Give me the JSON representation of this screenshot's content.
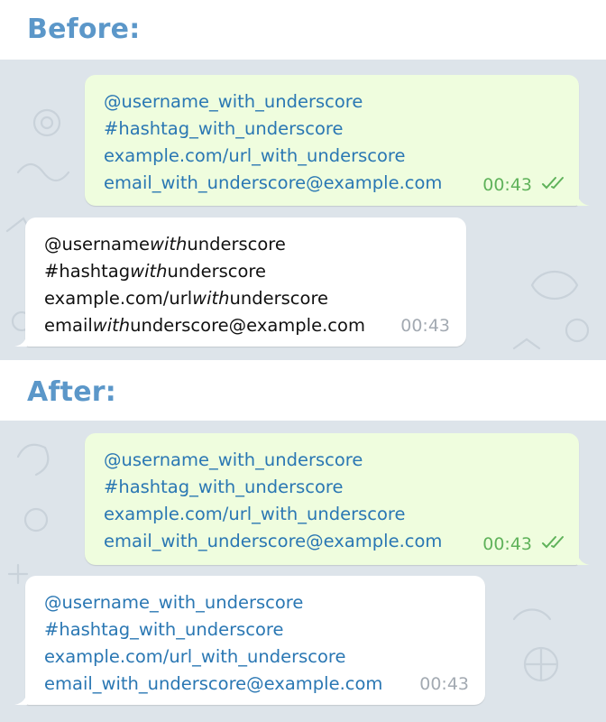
{
  "before": {
    "heading": "Before:",
    "sent_message": {
      "lines": [
        "@username_with_underscore",
        "#hashtag_with_underscore",
        "example.com/url_with_underscore",
        "email_with_underscore@example.com"
      ],
      "time": "00:43",
      "status_icon": "double-check-icon"
    },
    "received_message": {
      "lines": [
        {
          "pre": "@username",
          "ital": "with",
          "post": "underscore"
        },
        {
          "pre": "#hashtag",
          "ital": "with",
          "post": "underscore"
        },
        {
          "pre": "example.com/url",
          "ital": "with",
          "post": "underscore"
        },
        {
          "pre": "email",
          "ital": "with",
          "post": "underscore@example.com"
        }
      ],
      "time": "00:43"
    }
  },
  "after": {
    "heading": "After:",
    "sent_message": {
      "lines": [
        "@username_with_underscore",
        "#hashtag_with_underscore",
        "example.com/url_with_underscore",
        "email_with_underscore@example.com"
      ],
      "time": "00:43",
      "status_icon": "double-check-icon"
    },
    "received_message": {
      "lines": [
        "@username_with_underscore",
        "#hashtag_with_underscore",
        "example.com/url_with_underscore",
        "email_with_underscore@example.com"
      ],
      "time": "00:43"
    }
  },
  "colors": {
    "heading": "#5b97c9",
    "chat_background": "#dde4ea",
    "outgoing_bubble": "#effdde",
    "incoming_bubble": "#ffffff",
    "link": "#2a77b3",
    "outgoing_time": "#5fb25a",
    "incoming_time": "#a3aab2"
  }
}
